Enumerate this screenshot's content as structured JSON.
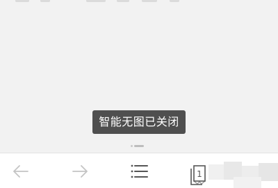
{
  "toast": {
    "message": "智能无图已关闭"
  },
  "toolbar": {
    "buttons": [
      {
        "name": "back",
        "icon": "arrow-left-icon",
        "enabled": false
      },
      {
        "name": "forward",
        "icon": "arrow-right-icon",
        "enabled": false
      },
      {
        "name": "menu",
        "icon": "menu-icon",
        "enabled": true
      },
      {
        "name": "tabs",
        "icon": "tabs-icon",
        "enabled": true
      }
    ],
    "tab_count": "1"
  },
  "colors": {
    "background": "#f2f2f2",
    "toast_background": "#4f4f4f",
    "toast_text": "#ffffff",
    "toolbar_background": "#ffffff",
    "icon_disabled": "#c4c4c4",
    "icon_enabled": "#555555"
  }
}
